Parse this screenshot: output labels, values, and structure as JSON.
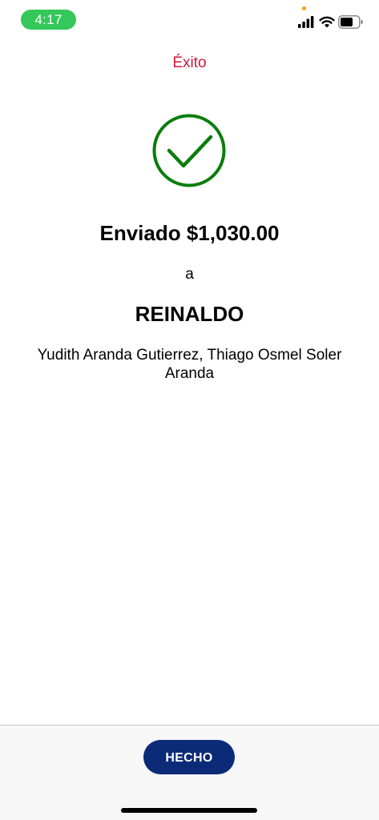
{
  "status_bar": {
    "time": "4:17",
    "time_pill_color": "#34c759",
    "icons": [
      "cellular-signal-icon",
      "wifi-icon",
      "battery-icon"
    ]
  },
  "header": {
    "title": "Éxito",
    "title_color": "#d0183f"
  },
  "result": {
    "icon": "checkmark-circle-icon",
    "icon_color": "#0a7d0a",
    "amount_text": "Enviado $1,030.00",
    "preposition": "a",
    "recipient_name": "REINALDO",
    "recipient_detail": "Yudith Aranda Gutierrez, Thiago Osmel Soler Aranda"
  },
  "footer": {
    "done_label": "HECHO",
    "button_color": "#0b2a78"
  }
}
